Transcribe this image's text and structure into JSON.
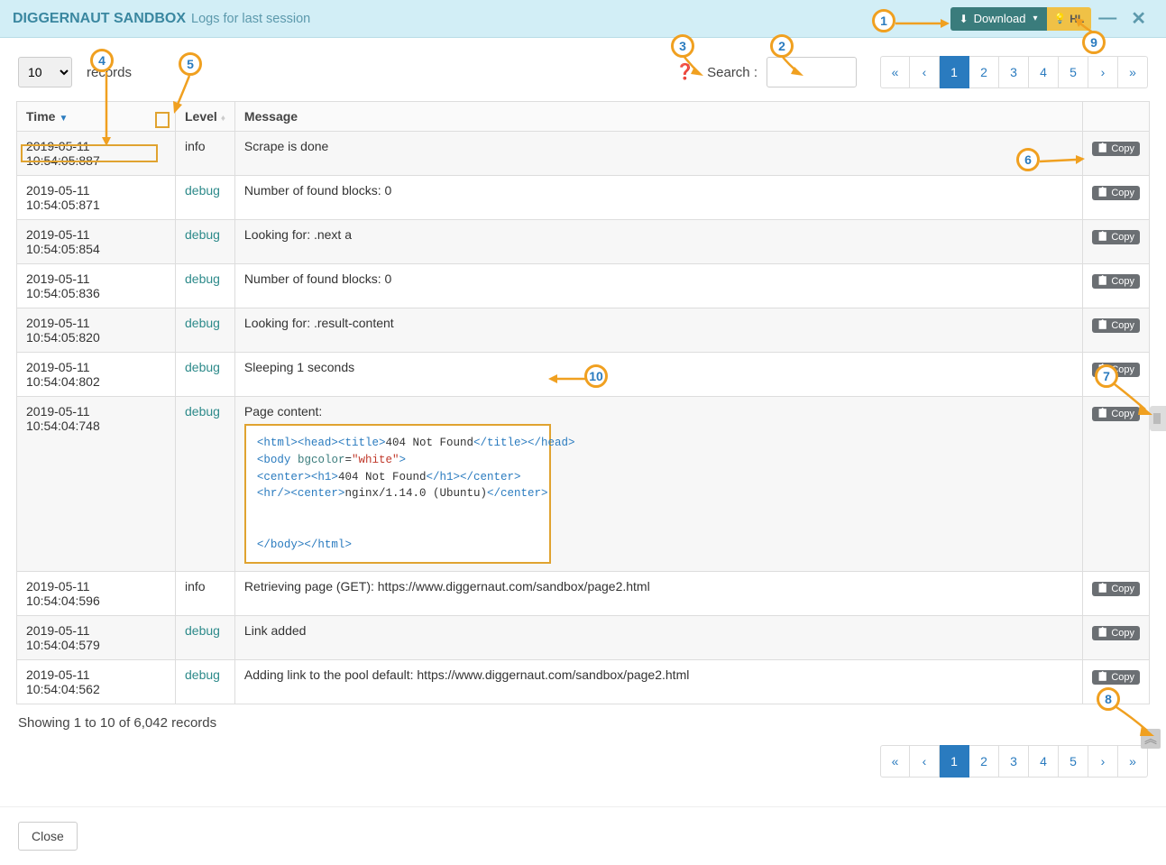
{
  "header": {
    "title": "DIGGERNAUT SANDBOX",
    "subtitle": "Logs for last session",
    "download_label": "Download",
    "hl_label": "HL"
  },
  "toolbar": {
    "records_options": [
      "10"
    ],
    "records_value": "10",
    "records_label": "records",
    "search_label": "Search :",
    "search_value": ""
  },
  "columns": {
    "time": "Time",
    "level": "Level",
    "message": "Message"
  },
  "pages": [
    "1",
    "2",
    "3",
    "4",
    "5"
  ],
  "active_page": "1",
  "copy_label": "Copy",
  "rows": [
    {
      "time": "2019-05-11 10:54:05:887",
      "level": "info",
      "message": "Scrape is done"
    },
    {
      "time": "2019-05-11 10:54:05:871",
      "level": "debug",
      "message": "Number of found blocks: 0"
    },
    {
      "time": "2019-05-11 10:54:05:854",
      "level": "debug",
      "message": "Looking for: .next a"
    },
    {
      "time": "2019-05-11 10:54:05:836",
      "level": "debug",
      "message": "Number of found blocks: 0"
    },
    {
      "time": "2019-05-11 10:54:05:820",
      "level": "debug",
      "message": "Looking for: .result-content"
    },
    {
      "time": "2019-05-11 10:54:04:802",
      "level": "debug",
      "message": "Sleeping 1 seconds"
    },
    {
      "time": "2019-05-11 10:54:04:748",
      "level": "debug",
      "message": "Page content:",
      "code": true
    },
    {
      "time": "2019-05-11 10:54:04:596",
      "level": "info",
      "message": "Retrieving page (GET): https://www.diggernaut.com/sandbox/page2.html"
    },
    {
      "time": "2019-05-11 10:54:04:579",
      "level": "debug",
      "message": "Link added"
    },
    {
      "time": "2019-05-11 10:54:04:562",
      "level": "debug",
      "message": "Adding link to the pool default: https://www.diggernaut.com/sandbox/page2.html"
    }
  ],
  "code_content": {
    "line1_pre": "<html><head><title>",
    "line1_mid": "404 Not Found",
    "line1_post": "</title></head>",
    "line2_pre": "<body ",
    "line2_attr": "bgcolor",
    "line2_eq": "=",
    "line2_val": "\"white\"",
    "line2_post": ">",
    "line3_pre": "<center><h1>",
    "line3_mid": "404 Not Found",
    "line3_post": "</h1></center>",
    "line4_pre": "<hr/><center>",
    "line4_mid": "nginx/1.14.0 (Ubuntu)",
    "line4_post": "</center>",
    "line5": "</body></html>"
  },
  "count_info": "Showing 1 to 10 of 6,042 records",
  "close_label": "Close",
  "annotations": [
    "1",
    "2",
    "3",
    "4",
    "5",
    "6",
    "7",
    "8",
    "9",
    "10"
  ]
}
